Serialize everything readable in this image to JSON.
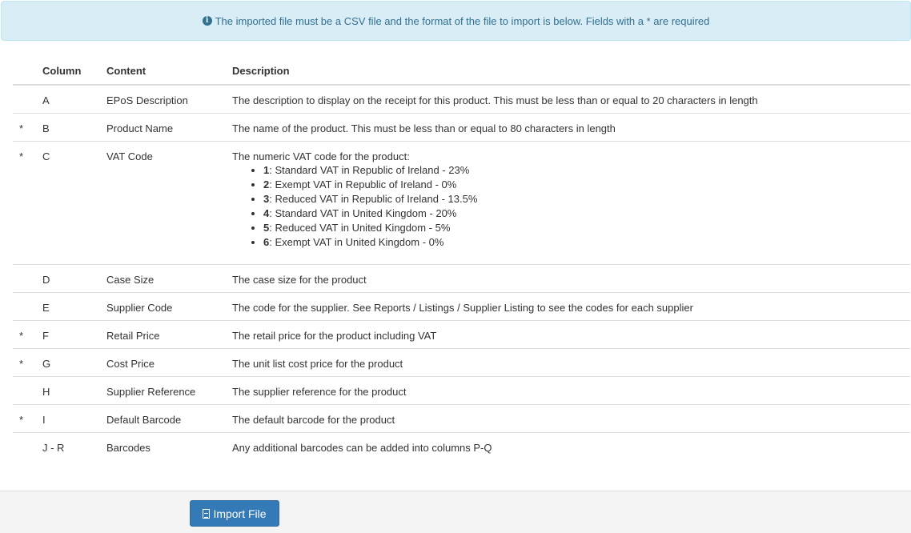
{
  "alert": {
    "icon": "info-circle-icon",
    "text": "The imported file must be a CSV file and the format of the file to import is below. Fields with a * are required"
  },
  "table": {
    "headers": [
      "",
      "Column",
      "Content",
      "Description"
    ],
    "rows": [
      {
        "req": "",
        "col": "A",
        "content": "EPoS Description",
        "desc": "The description to display on the receipt for this product. This must be less than or equal to 20 characters in length"
      },
      {
        "req": "*",
        "col": "B",
        "content": "Product Name",
        "desc": "The name of the product. This must be less than or equal to 80 characters in length"
      },
      {
        "req": "*",
        "col": "C",
        "content": "VAT Code",
        "desc": "The numeric VAT code for the product:",
        "items": [
          {
            "code": "1",
            "text": ": Standard VAT in Republic of Ireland - 23%"
          },
          {
            "code": "2",
            "text": ": Exempt VAT in Republic of Ireland - 0%"
          },
          {
            "code": "3",
            "text": ": Reduced VAT in Republic of Ireland - 13.5%"
          },
          {
            "code": "4",
            "text": ": Standard VAT in United Kingdom - 20%"
          },
          {
            "code": "5",
            "text": ": Reduced VAT in United Kingdom - 5%"
          },
          {
            "code": "6",
            "text": ": Exempt VAT in United Kingdom - 0%"
          }
        ]
      },
      {
        "req": "",
        "col": "D",
        "content": "Case Size",
        "desc": "The case size for the product"
      },
      {
        "req": "",
        "col": "E",
        "content": "Supplier Code",
        "desc": "The code for the supplier. See Reports / Listings / Supplier Listing to see the codes for each supplier"
      },
      {
        "req": "*",
        "col": "F",
        "content": "Retail Price",
        "desc": "The retail price for the product including VAT"
      },
      {
        "req": "*",
        "col": "G",
        "content": "Cost Price",
        "desc": "The unit list cost price for the product"
      },
      {
        "req": "",
        "col": "H",
        "content": "Supplier Reference",
        "desc": "The supplier reference for the product"
      },
      {
        "req": "*",
        "col": "I",
        "content": "Default Barcode",
        "desc": "The default barcode for the product"
      },
      {
        "req": "",
        "col": "J - R",
        "content": "Barcodes",
        "desc": "Any additional barcodes can be added into columns P-Q"
      }
    ]
  },
  "footer": {
    "import_label": "Import File",
    "import_icon": "file-text-icon"
  },
  "colors": {
    "alert_bg": "#d9edf7",
    "alert_text": "#31708f",
    "button": "#337ab7"
  }
}
